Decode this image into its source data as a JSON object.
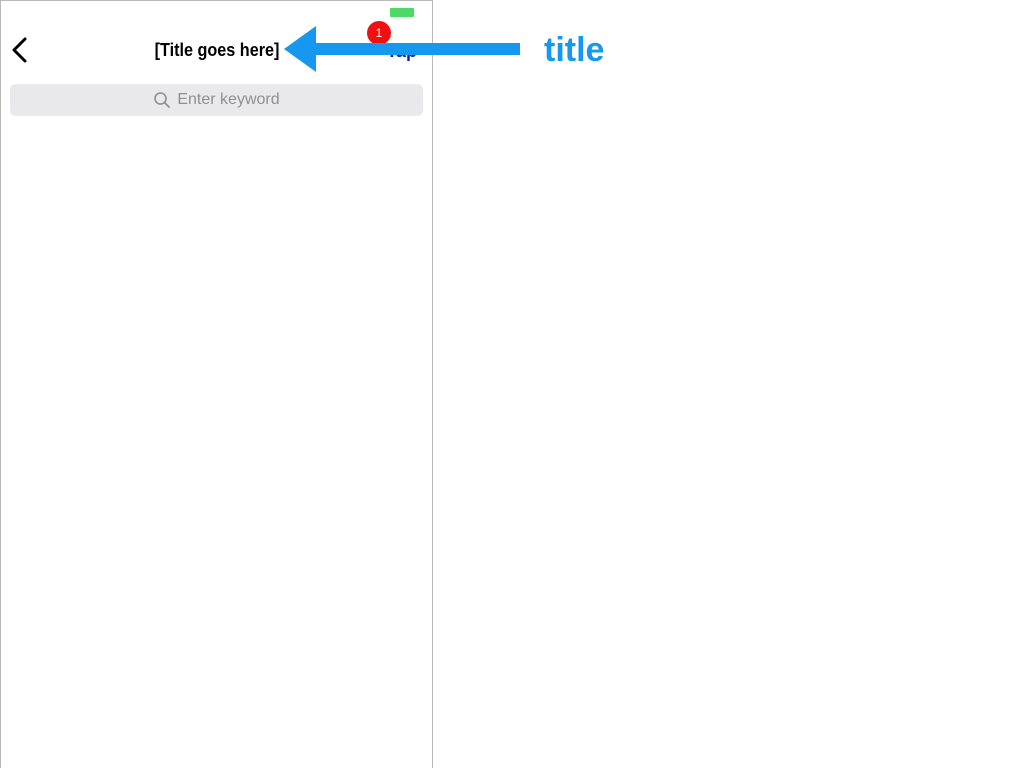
{
  "status_bar": {
    "battery_color": "#4cd964"
  },
  "nav": {
    "back_icon": "chevron-left-icon",
    "title": "[Title goes here]",
    "action_label": "Tap",
    "action_color": "#0a1fc8",
    "badge_count": "1",
    "badge_color": "#f01010"
  },
  "search": {
    "icon": "search-icon",
    "placeholder": "Enter keyword",
    "background": "#e9e9eb"
  },
  "annotation": {
    "label": "title",
    "color": "#1798f0",
    "arrow_icon": "arrow-left-icon"
  }
}
